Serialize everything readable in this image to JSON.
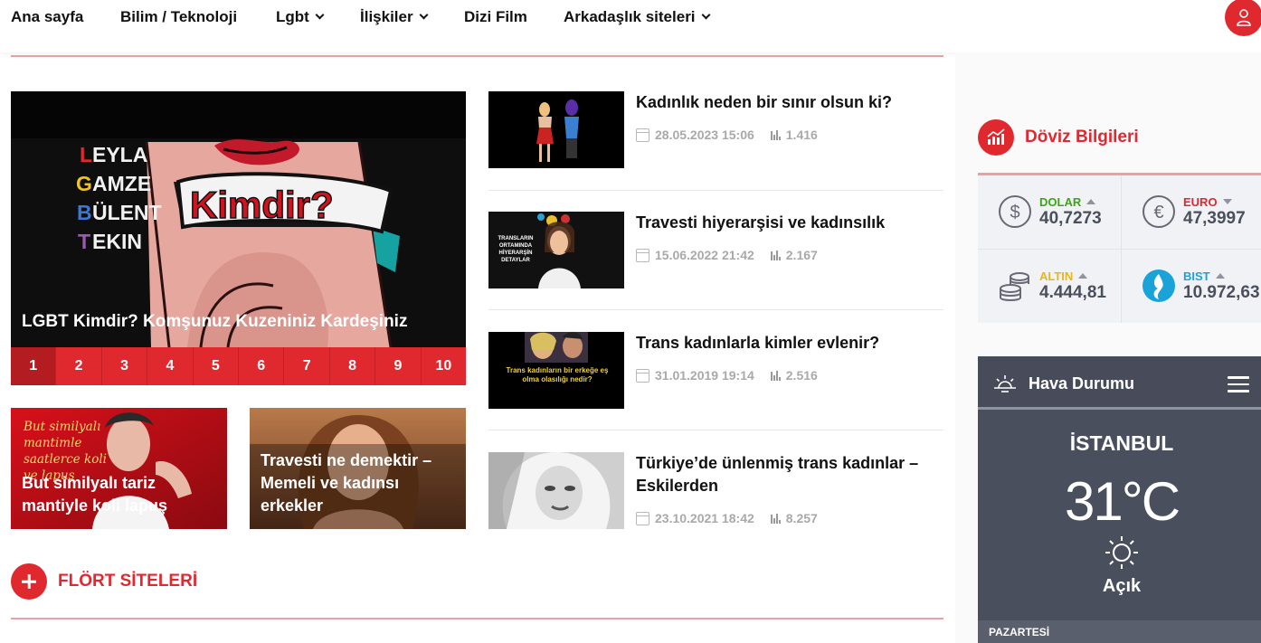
{
  "nav": {
    "items": [
      {
        "label": "Ana sayfa",
        "dropdown": false
      },
      {
        "label": "Bilim / Teknoloji",
        "dropdown": false
      },
      {
        "label": "Lgbt",
        "dropdown": true
      },
      {
        "label": "İlişkiler",
        "dropdown": true
      },
      {
        "label": "Dizi Film",
        "dropdown": false
      },
      {
        "label": "Arkadaşlık siteleri",
        "dropdown": true
      }
    ],
    "user_icon": "user-icon"
  },
  "slider": {
    "art_lines": [
      "EYLA",
      "AMZE",
      "ÜLENT",
      "EKIN"
    ],
    "art_initials": [
      "L",
      "G",
      "B",
      "T"
    ],
    "art_word": "Kimdir?",
    "title": "LGBT Kimdir? Komşunuz Kuzeniniz Kardeşiniz",
    "pages": [
      "1",
      "2",
      "3",
      "4",
      "5",
      "6",
      "7",
      "8",
      "9",
      "10"
    ],
    "active_page": "1"
  },
  "cards": [
    {
      "title": "But similyalı tariz mantiyle koli lapuş",
      "art_text": "But similyalı mantimle saatlerce koli ve lapuş"
    },
    {
      "title": "Travesti ne demektir – Memeli ve kadınsı erkekler"
    }
  ],
  "articles": [
    {
      "title": "Kadınlık neden bir sınır olsun ki?",
      "date": "28.05.2023 15:06",
      "views": "1.416"
    },
    {
      "title": "Travesti hiyerarşisi ve kadınsılık",
      "date": "15.06.2022 21:42",
      "views": "2.167",
      "thumb_text": "TRANSLARIN ORTAMINDA HİYERARŞİN DETAYLAR"
    },
    {
      "title": "Trans kadınlarla kimler evlenir?",
      "date": "31.01.2019 19:14",
      "views": "2.516",
      "thumb_text": "Trans kadınların bir erkeğe eş olma olasılığı nedir?"
    },
    {
      "title": "Türkiye’de ünlenmiş trans kadınlar – Eskilerden",
      "date": "23.10.2021 18:42",
      "views": "8.257"
    }
  ],
  "section": {
    "title": "FLÖRT SİTELERİ"
  },
  "doviz": {
    "title": "Döviz Bilgileri",
    "items": [
      {
        "name": "DOLAR",
        "value": "40,7273",
        "trend": "up",
        "color": "#3ba515",
        "icon": "dollar-icon"
      },
      {
        "name": "EURO",
        "value": "47,3997",
        "trend": "down",
        "color": "#e0292f",
        "icon": "euro-icon"
      },
      {
        "name": "ALTIN",
        "value": "4.444,81",
        "trend": "up",
        "color": "#e8b51a",
        "icon": "gold-coins-icon"
      },
      {
        "name": "BIST",
        "value": "10.972,63",
        "trend": "up",
        "color": "#1aa3d9",
        "icon": "bist-logo-icon"
      }
    ]
  },
  "weather": {
    "title": "Hava Durumu",
    "city": "İSTANBUL",
    "temp": "31°C",
    "condition": "Açık",
    "day_label": "PAZARTESİ"
  },
  "colors": {
    "accent": "#e0292f",
    "rule": "#e8a0a2",
    "weather_bg": "#4a4f5e"
  }
}
